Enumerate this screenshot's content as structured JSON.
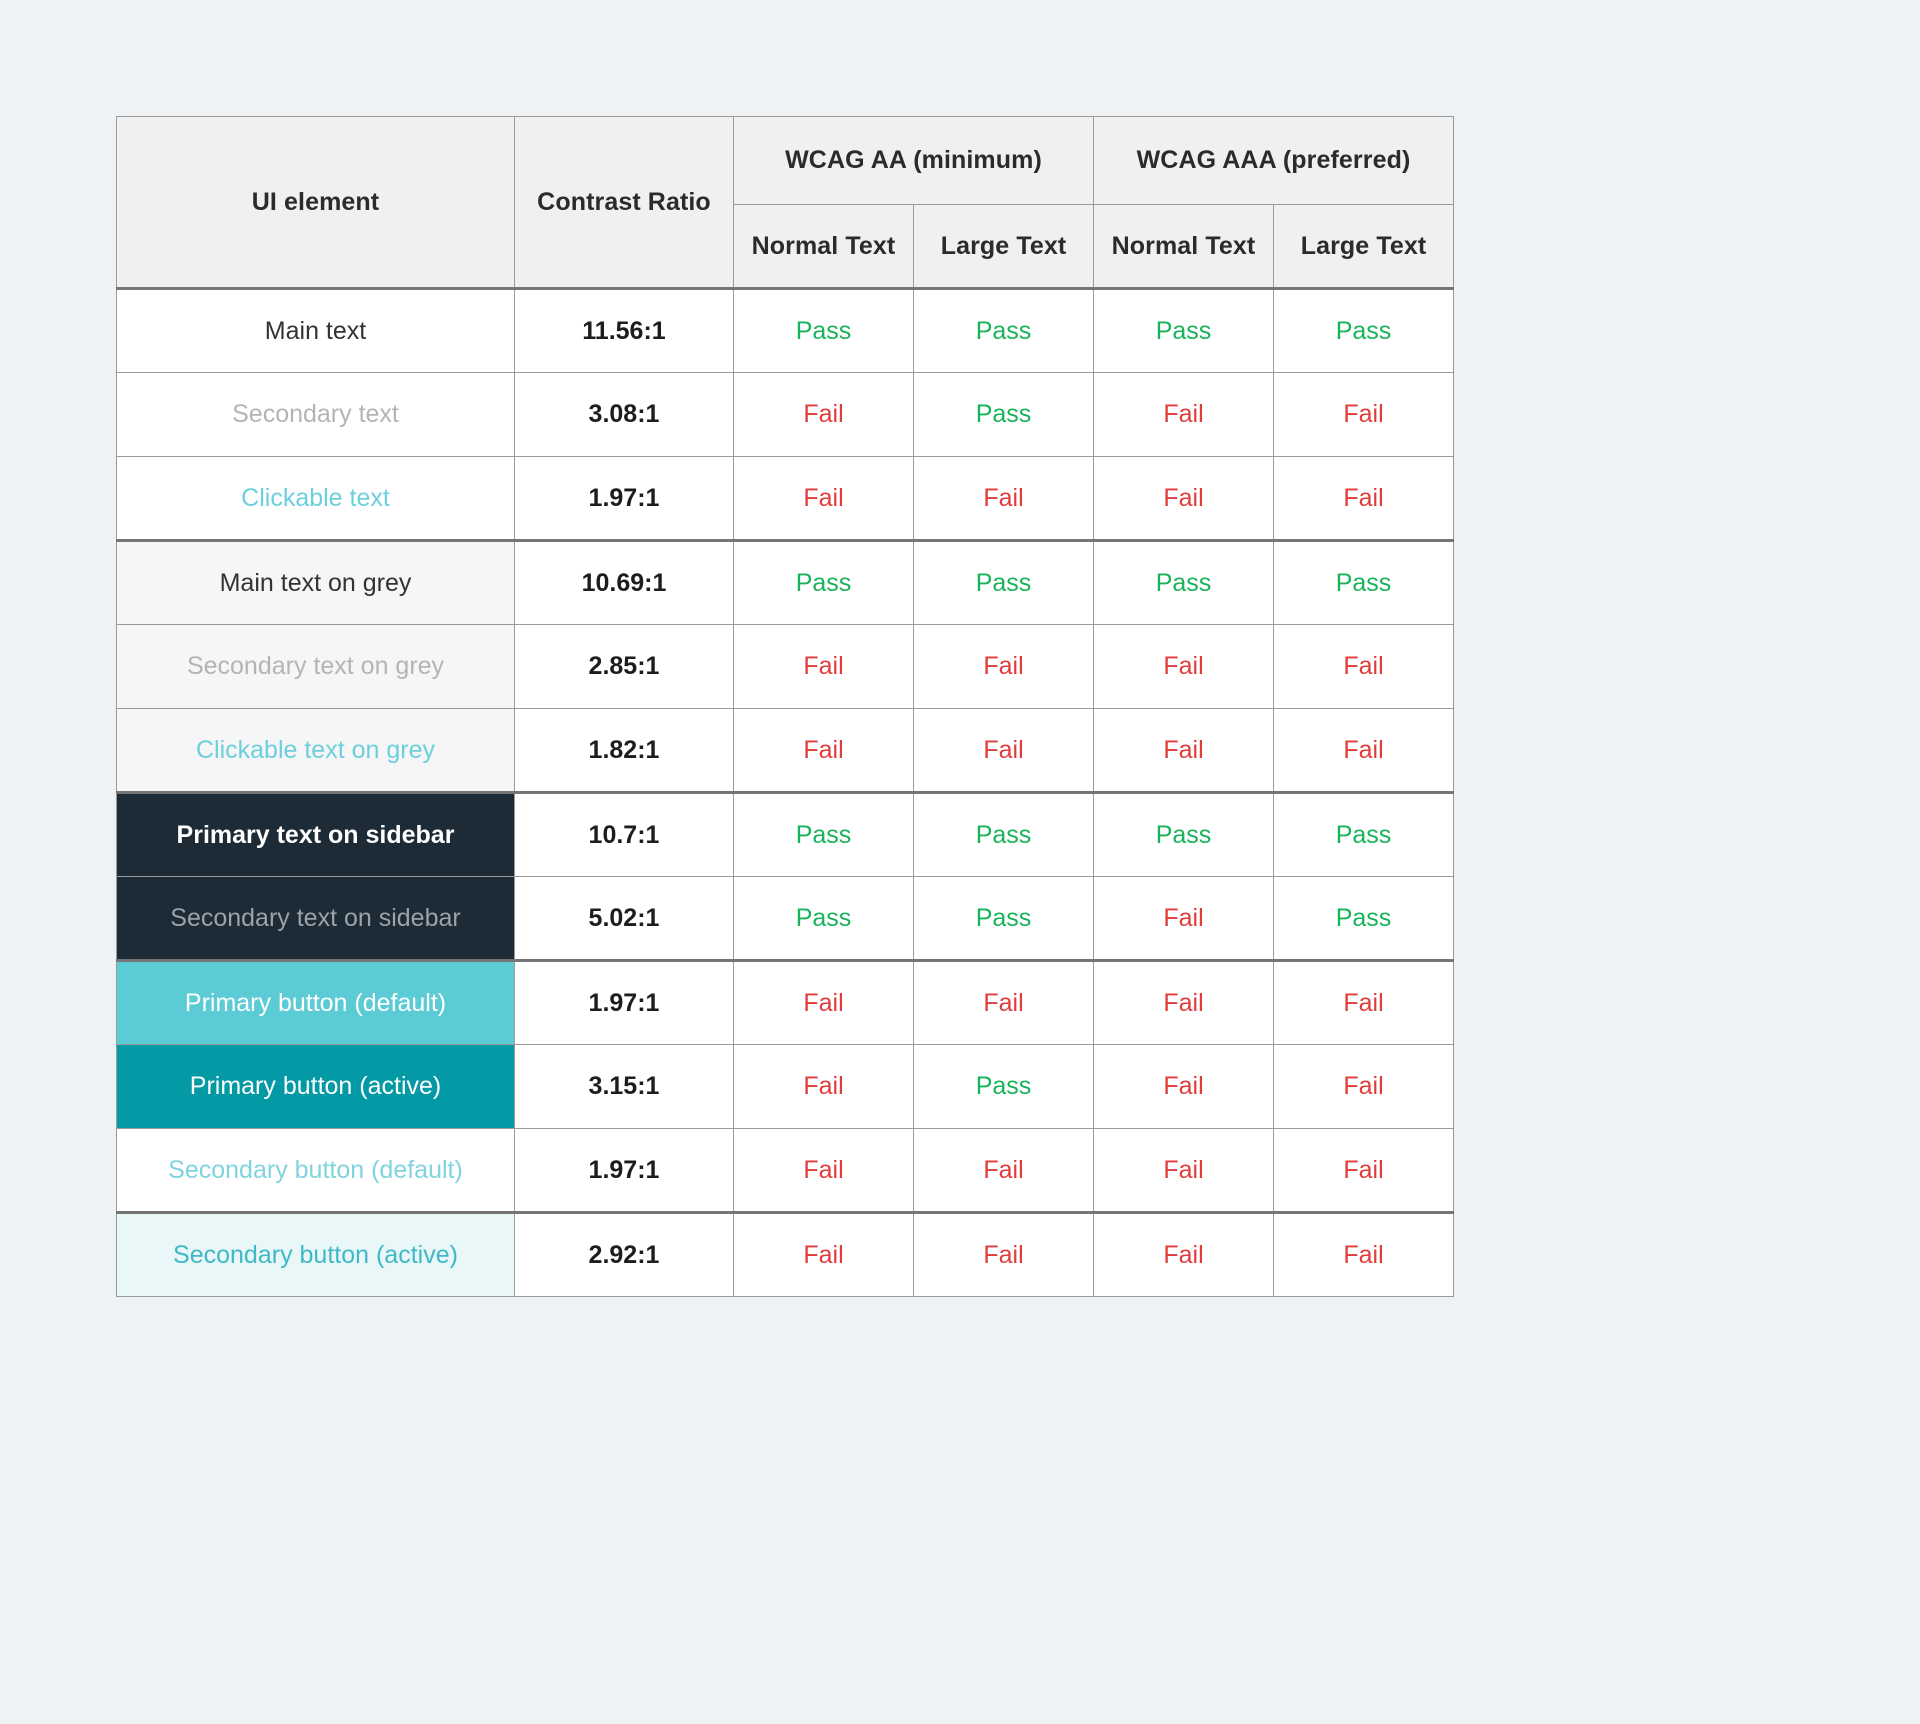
{
  "page": {
    "background_color": "#eef2f4"
  },
  "table": {
    "name": "wcag-contrast-ratio-table",
    "headers": {
      "ui_element": "UI element",
      "contrast_ratio": "Contrast Ratio",
      "groups": [
        {
          "label": "WCAG AA (minimum)",
          "sub": [
            "Normal Text",
            "Large Text"
          ]
        },
        {
          "label": "WCAG AAA (preferred)",
          "sub": [
            "Normal Text",
            "Large Text"
          ]
        }
      ]
    },
    "colors": {
      "pass": "#19b35a",
      "fail": "#e23b3b",
      "header_bg": "#f0f0f0",
      "border": "#9a9a9a",
      "grey_row_bg": "#f6f6f6",
      "sidebar_bg": "#1d2b36",
      "primary_button_default": "#5bcbd6",
      "primary_button_active": "#039aa6",
      "secondary_button_active_bg": "#e9f7f9",
      "clickable_text": "#6dcfdd",
      "main_text": "#333333",
      "secondary_text": "#b4b4b4"
    },
    "rows": [
      {
        "element": "Main text",
        "style": "s-main",
        "ratio": "11.56:1",
        "aa_normal": "Pass",
        "aa_large": "Pass",
        "aaa_normal": "Pass",
        "aaa_large": "Pass"
      },
      {
        "element": "Secondary text",
        "style": "s-secondary",
        "ratio": "3.08:1",
        "aa_normal": "Fail",
        "aa_large": "Pass",
        "aaa_normal": "Fail",
        "aaa_large": "Fail"
      },
      {
        "element": "Clickable text",
        "style": "s-clickable",
        "ratio": "1.97:1",
        "aa_normal": "Fail",
        "aa_large": "Fail",
        "aaa_normal": "Fail",
        "aaa_large": "Fail"
      },
      {
        "element": "Main text on grey",
        "style": "s-main-grey",
        "ratio": "10.69:1",
        "aa_normal": "Pass",
        "aa_large": "Pass",
        "aaa_normal": "Pass",
        "aaa_large": "Pass"
      },
      {
        "element": "Secondary text on grey",
        "style": "s-sec-grey",
        "ratio": "2.85:1",
        "aa_normal": "Fail",
        "aa_large": "Fail",
        "aaa_normal": "Fail",
        "aaa_large": "Fail"
      },
      {
        "element": "Clickable text on grey",
        "style": "s-click-grey",
        "ratio": "1.82:1",
        "aa_normal": "Fail",
        "aa_large": "Fail",
        "aaa_normal": "Fail",
        "aaa_large": "Fail"
      },
      {
        "element": "Primary text on sidebar",
        "style": "s-sidebar-pri",
        "ratio": "10.7:1",
        "aa_normal": "Pass",
        "aa_large": "Pass",
        "aaa_normal": "Pass",
        "aaa_large": "Pass"
      },
      {
        "element": "Secondary text on sidebar",
        "style": "s-sidebar-sec",
        "ratio": "5.02:1",
        "aa_normal": "Pass",
        "aa_large": "Pass",
        "aaa_normal": "Fail",
        "aaa_large": "Pass"
      },
      {
        "element": "Primary button (default)",
        "style": "s-btn-pri-def",
        "ratio": "1.97:1",
        "aa_normal": "Fail",
        "aa_large": "Fail",
        "aaa_normal": "Fail",
        "aaa_large": "Fail"
      },
      {
        "element": "Primary button (active)",
        "style": "s-btn-pri-act",
        "ratio": "3.15:1",
        "aa_normal": "Fail",
        "aa_large": "Pass",
        "aaa_normal": "Fail",
        "aaa_large": "Fail"
      },
      {
        "element": "Secondary button (default)",
        "style": "s-btn-sec-def",
        "ratio": "1.97:1",
        "aa_normal": "Fail",
        "aa_large": "Fail",
        "aaa_normal": "Fail",
        "aaa_large": "Fail"
      },
      {
        "element": "Secondary button (active)",
        "style": "s-btn-sec-act",
        "ratio": "2.92:1",
        "aa_normal": "Fail",
        "aa_large": "Fail",
        "aaa_normal": "Fail",
        "aaa_large": "Fail"
      }
    ]
  }
}
